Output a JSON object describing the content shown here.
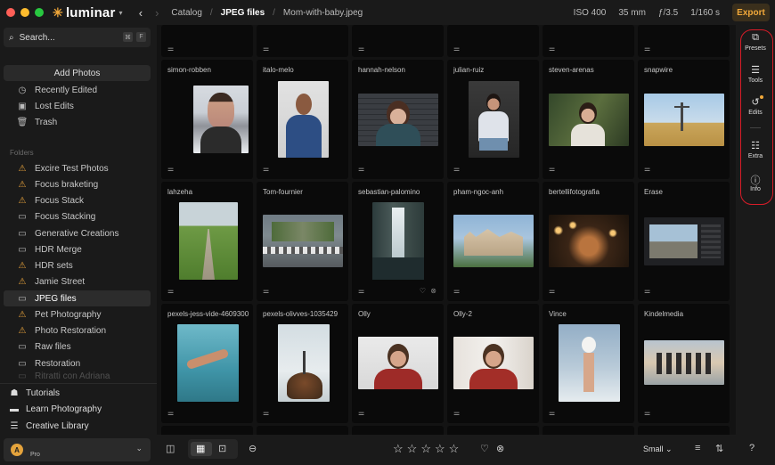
{
  "topbar": {
    "app_name": "luminar",
    "breadcrumbs": [
      "Catalog",
      "JPEG files",
      "Mom-with-baby.jpeg"
    ],
    "meta": [
      "ISO 400",
      "35 mm",
      "ƒ/3.5",
      "1/160 s"
    ],
    "export_label": "Export",
    "accent_color": "#f1a83a"
  },
  "sidebar": {
    "search_placeholder": "Search...",
    "search_shortcut": [
      "⌘",
      "F"
    ],
    "add_photos": "Add Photos",
    "library": [
      {
        "label": "Recently Edited",
        "icon": "recent-icon"
      },
      {
        "label": "Lost Edits",
        "icon": "lost-edits-icon"
      },
      {
        "label": "Trash",
        "icon": "trash-icon"
      }
    ],
    "folders_header": "Folders",
    "folders": [
      {
        "label": "Excire Test Photos",
        "icon": "warning-icon"
      },
      {
        "label": "Focus braketing",
        "icon": "warning-icon"
      },
      {
        "label": "Focus Stack",
        "icon": "warning-icon"
      },
      {
        "label": "Focus Stacking",
        "icon": "folder-icon"
      },
      {
        "label": "Generative Creations",
        "icon": "folder-icon"
      },
      {
        "label": "HDR Merge",
        "icon": "folder-icon"
      },
      {
        "label": "HDR sets",
        "icon": "warning-icon"
      },
      {
        "label": "Jamie Street",
        "icon": "warning-icon"
      },
      {
        "label": "JPEG files",
        "icon": "folder-icon",
        "selected": true
      },
      {
        "label": "Pet Photography",
        "icon": "warning-icon"
      },
      {
        "label": "Photo Restoration",
        "icon": "warning-icon"
      },
      {
        "label": "Raw files",
        "icon": "folder-icon"
      },
      {
        "label": "Restoration",
        "icon": "folder-icon"
      },
      {
        "label": "Ritratti con Adriana",
        "icon": "folder-icon"
      }
    ],
    "bottom_links": [
      {
        "label": "Tutorials",
        "icon": "tutorials-icon"
      },
      {
        "label": "Learn Photography",
        "icon": "learn-icon"
      },
      {
        "label": "Creative Library",
        "icon": "library-icon"
      }
    ],
    "account": {
      "initial": "A",
      "plan": "Pro"
    }
  },
  "grid": {
    "rows": [
      [
        {
          "name": "simon-robben",
          "thumb": "portrait-man"
        },
        {
          "name": "italo-melo",
          "thumb": "portrait-smiling-man"
        },
        {
          "name": "hannah-nelson",
          "thumb": "portrait-woman-brick"
        },
        {
          "name": "julian-ruiz",
          "thumb": "portrait-woman-sitting"
        },
        {
          "name": "steven-arenas",
          "thumb": "portrait-woman-trees"
        },
        {
          "name": "snapwire",
          "thumb": "power-line-field"
        }
      ],
      [
        {
          "name": "lahzeha",
          "thumb": "country-road"
        },
        {
          "name": "Tom-fournier",
          "thumb": "city-crosswalk"
        },
        {
          "name": "sebastian-palomino",
          "thumb": "waterfall",
          "has_actions": true
        },
        {
          "name": "pham-ngoc-anh",
          "thumb": "castle-building"
        },
        {
          "name": "bertellifotografia",
          "thumb": "night-lights"
        },
        {
          "name": "Erase",
          "thumb": "screenshot"
        }
      ],
      [
        {
          "name": "pexels-jess-vide-4609300",
          "thumb": "underwater-swimmer"
        },
        {
          "name": "pexels-olivves-1035429",
          "thumb": "turtle-rock"
        },
        {
          "name": "Olly",
          "thumb": "portrait-man-red-shirt"
        },
        {
          "name": "Olly-2",
          "thumb": "portrait-man-red-shirt-window"
        },
        {
          "name": "Vince",
          "thumb": "hand-lightbulb"
        },
        {
          "name": "Kindelmedia",
          "thumb": "people-beach"
        }
      ]
    ]
  },
  "right_panel": {
    "tools": [
      {
        "label": "Presets",
        "icon": "presets-icon"
      },
      {
        "label": "Tools",
        "icon": "tools-icon"
      },
      {
        "label": "Edits",
        "icon": "edits-icon",
        "badge": true
      },
      {
        "label": "Extra",
        "icon": "extra-icon"
      },
      {
        "label": "Info",
        "icon": "info-icon"
      }
    ],
    "highlight_color": "#d81c28"
  },
  "bottombar": {
    "rating_stars": 5,
    "size_label": "Small",
    "size_options_visible": "Small"
  }
}
